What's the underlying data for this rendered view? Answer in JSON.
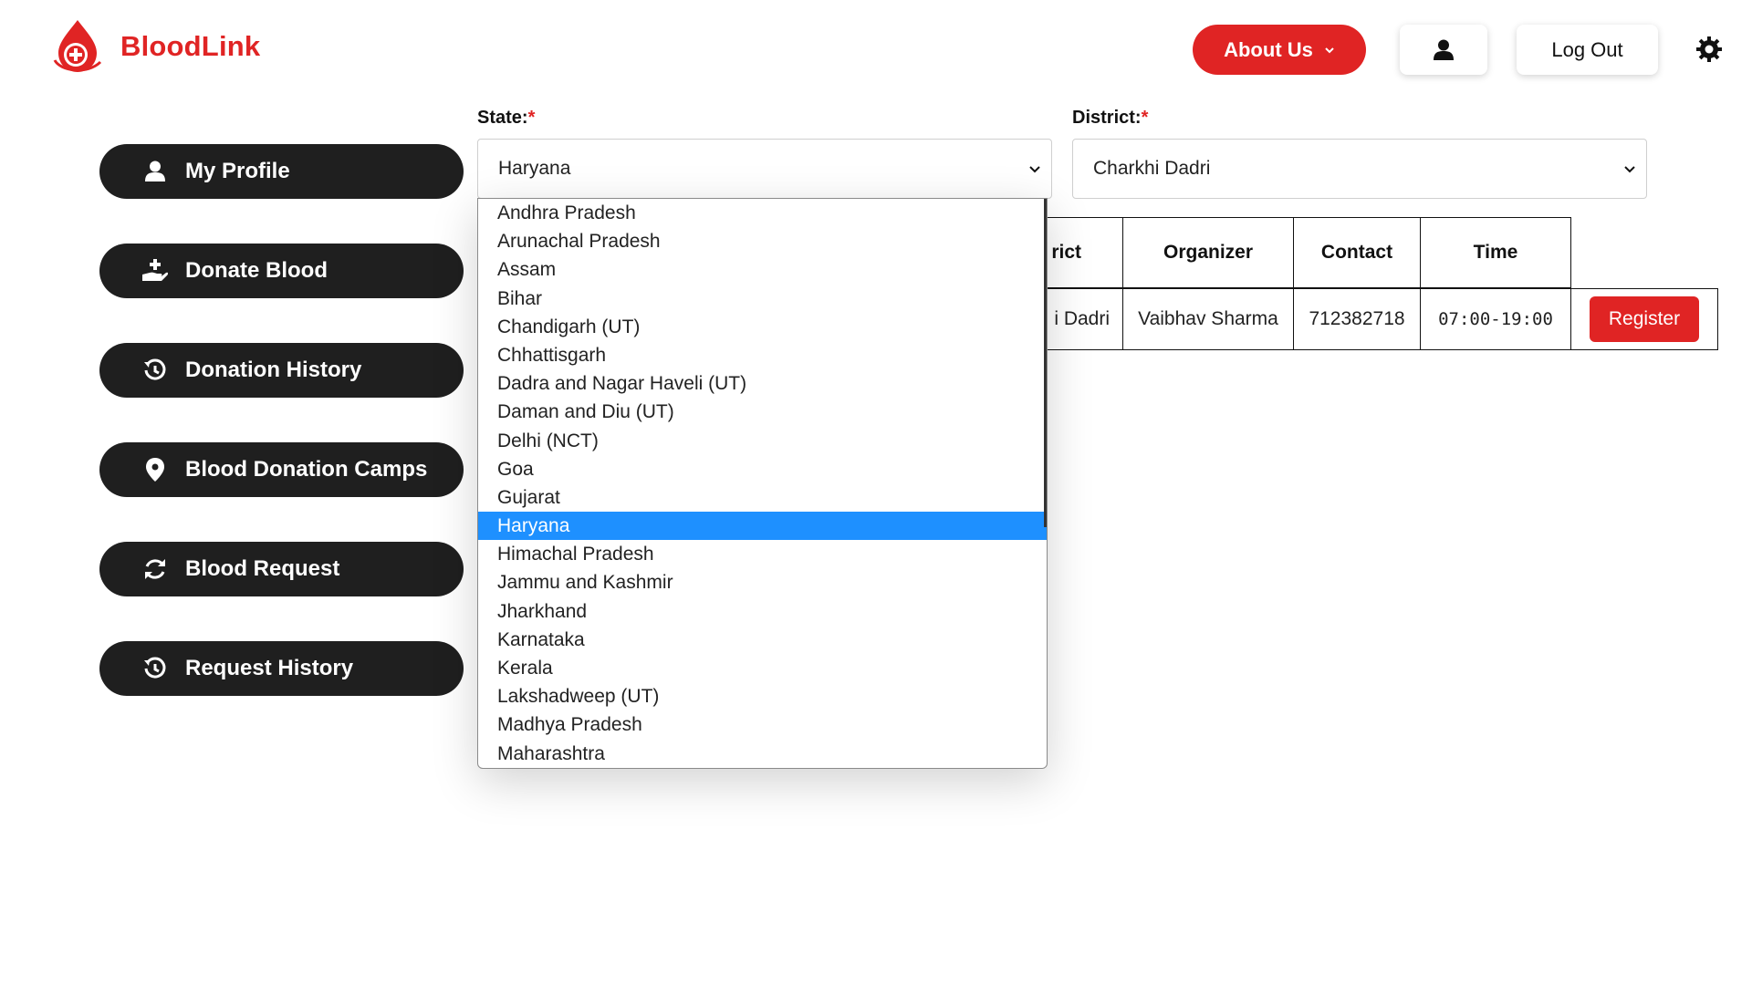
{
  "brand": {
    "name": "BloodLink",
    "accent": "#e02424"
  },
  "header": {
    "about_label": "About Us",
    "logout_label": "Log Out"
  },
  "sidebar": {
    "items": [
      {
        "label": "My Profile",
        "icon": "user-icon"
      },
      {
        "label": "Donate Blood",
        "icon": "hand-donate-icon"
      },
      {
        "label": "Donation History",
        "icon": "history-icon"
      },
      {
        "label": "Blood Donation Camps",
        "icon": "map-pin-icon"
      },
      {
        "label": "Blood Request",
        "icon": "refresh-icon"
      },
      {
        "label": "Request History",
        "icon": "history-icon"
      }
    ]
  },
  "form": {
    "state_label": "State:",
    "district_label": "District:",
    "required_mark": "*",
    "state_value": "Haryana",
    "district_value": "Charkhi Dadri"
  },
  "table": {
    "headers": [
      "rict",
      "Organizer",
      "Contact",
      "Time"
    ],
    "row": {
      "district": "i Dadri",
      "organizer": "Vaibhav Sharma",
      "contact": "712382718",
      "time": "07:00-19:00",
      "action": "Register"
    }
  },
  "state_options": [
    "Andhra Pradesh",
    "Arunachal Pradesh",
    "Assam",
    "Bihar",
    "Chandigarh (UT)",
    "Chhattisgarh",
    "Dadra and Nagar Haveli (UT)",
    "Daman and Diu (UT)",
    "Delhi (NCT)",
    "Goa",
    "Gujarat",
    "Haryana",
    "Himachal Pradesh",
    "Jammu and Kashmir",
    "Jharkhand",
    "Karnataka",
    "Kerala",
    "Lakshadweep (UT)",
    "Madhya Pradesh",
    "Maharashtra"
  ],
  "selected_option": "Haryana"
}
